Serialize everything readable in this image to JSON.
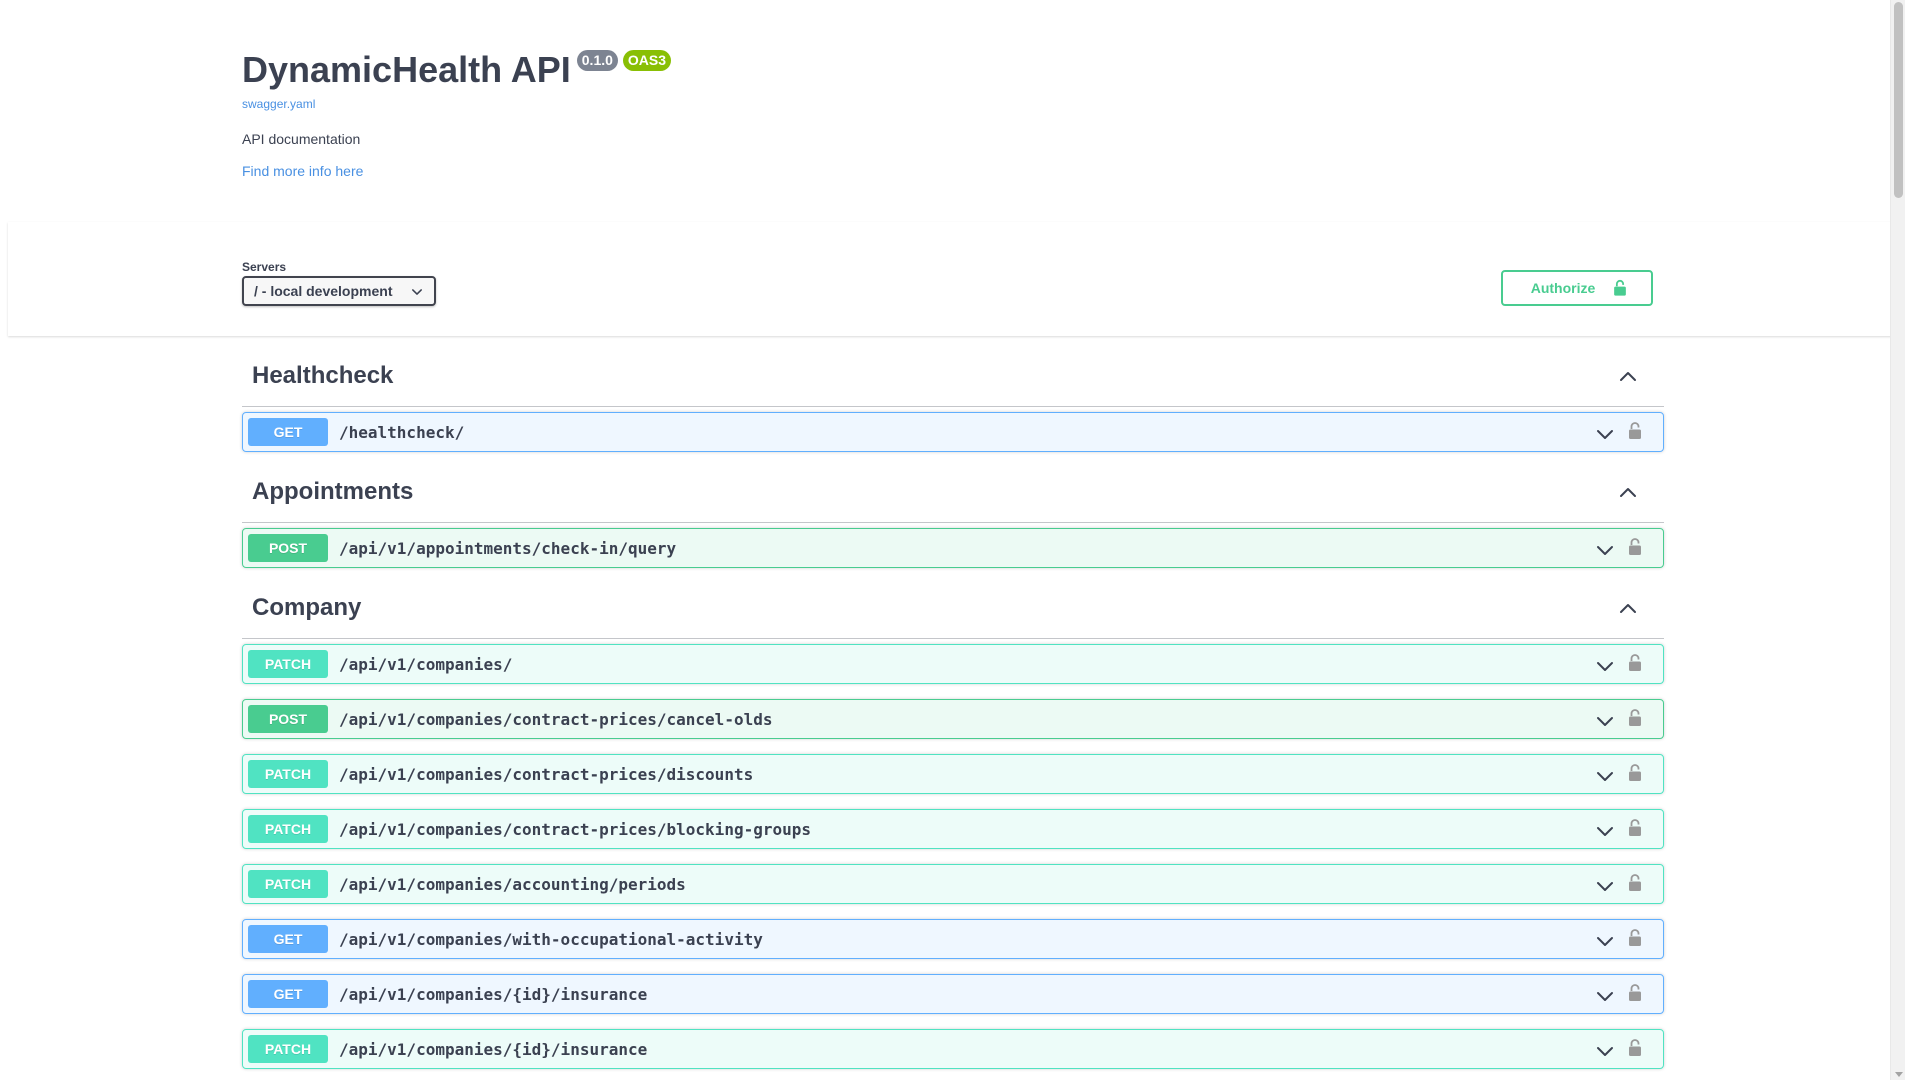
{
  "info": {
    "title": "DynamicHealth API",
    "version_badge": "0.1.0",
    "oas_badge": "OAS3",
    "spec_link": "swagger.yaml",
    "description": "API documentation",
    "more_info_link": "Find more info here"
  },
  "servers": {
    "label": "Servers",
    "selected": "/ - local development"
  },
  "authorize": {
    "label": "Authorize",
    "icon": "unlocked-icon",
    "color": "#49cc90"
  },
  "colors": {
    "get": "#61affe",
    "post": "#49cc90",
    "patch": "#50e3c2"
  },
  "tags": [
    {
      "name": "Healthcheck",
      "operations": [
        {
          "method": "GET",
          "path": "/healthcheck/"
        }
      ]
    },
    {
      "name": "Appointments",
      "operations": [
        {
          "method": "POST",
          "path": "/api/v1/appointments/check-in/query"
        }
      ]
    },
    {
      "name": "Company",
      "operations": [
        {
          "method": "PATCH",
          "path": "/api/v1/companies/"
        },
        {
          "method": "POST",
          "path": "/api/v1/companies/contract-prices/cancel-olds"
        },
        {
          "method": "PATCH",
          "path": "/api/v1/companies/contract-prices/discounts"
        },
        {
          "method": "PATCH",
          "path": "/api/v1/companies/contract-prices/blocking-groups"
        },
        {
          "method": "PATCH",
          "path": "/api/v1/companies/accounting/periods"
        },
        {
          "method": "GET",
          "path": "/api/v1/companies/with-occupational-activity"
        },
        {
          "method": "GET",
          "path": "/api/v1/companies/{id}/insurance"
        },
        {
          "method": "PATCH",
          "path": "/api/v1/companies/{id}/insurance"
        }
      ]
    }
  ]
}
